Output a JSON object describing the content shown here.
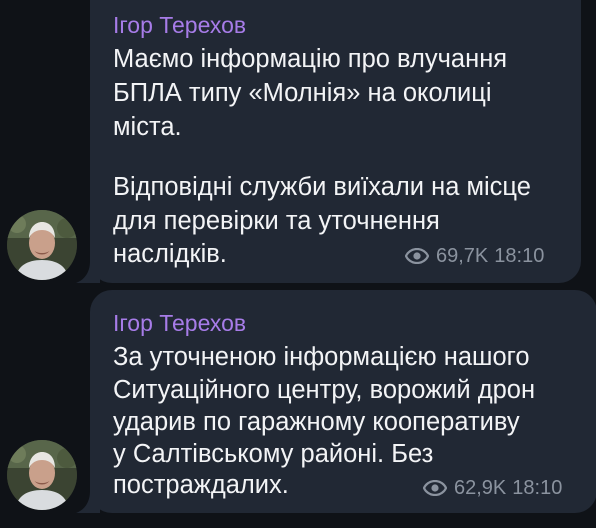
{
  "colors": {
    "background": "#0f1217",
    "bubble": "#212834",
    "sender_name": "#a77ce8",
    "message_text": "#f3f4f6",
    "meta_text": "#8b939f"
  },
  "messages": [
    {
      "sender": "Ігор Терехов",
      "lines": [
        "Маємо інформацію про влучання",
        "БПЛА типу «Молнія» на околиці",
        "міста.",
        "",
        "Відповідні служби виїхали на місце",
        "для перевірки та уточнення",
        "наслідків."
      ],
      "views": "69,7K",
      "time": "18:10",
      "views_icon": "eye-icon"
    },
    {
      "sender": "Ігор Терехов",
      "lines": [
        "За уточненою інформацією нашого",
        "Ситуаційного центру, ворожий дрон",
        "ударив по гаражному кооперативу",
        "у Салтівському районі. Без",
        "постраждалих."
      ],
      "views": "62,9K",
      "time": "18:10",
      "views_icon": "eye-icon"
    }
  ]
}
